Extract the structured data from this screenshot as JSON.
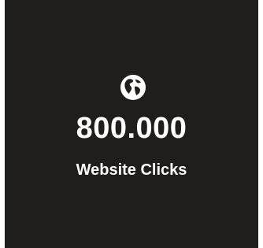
{
  "stat_card": {
    "icon": "globe-icon",
    "value": "800.000",
    "label": "Website Clicks",
    "background_color": "#1f1e1c",
    "text_color": "#ffffff"
  }
}
